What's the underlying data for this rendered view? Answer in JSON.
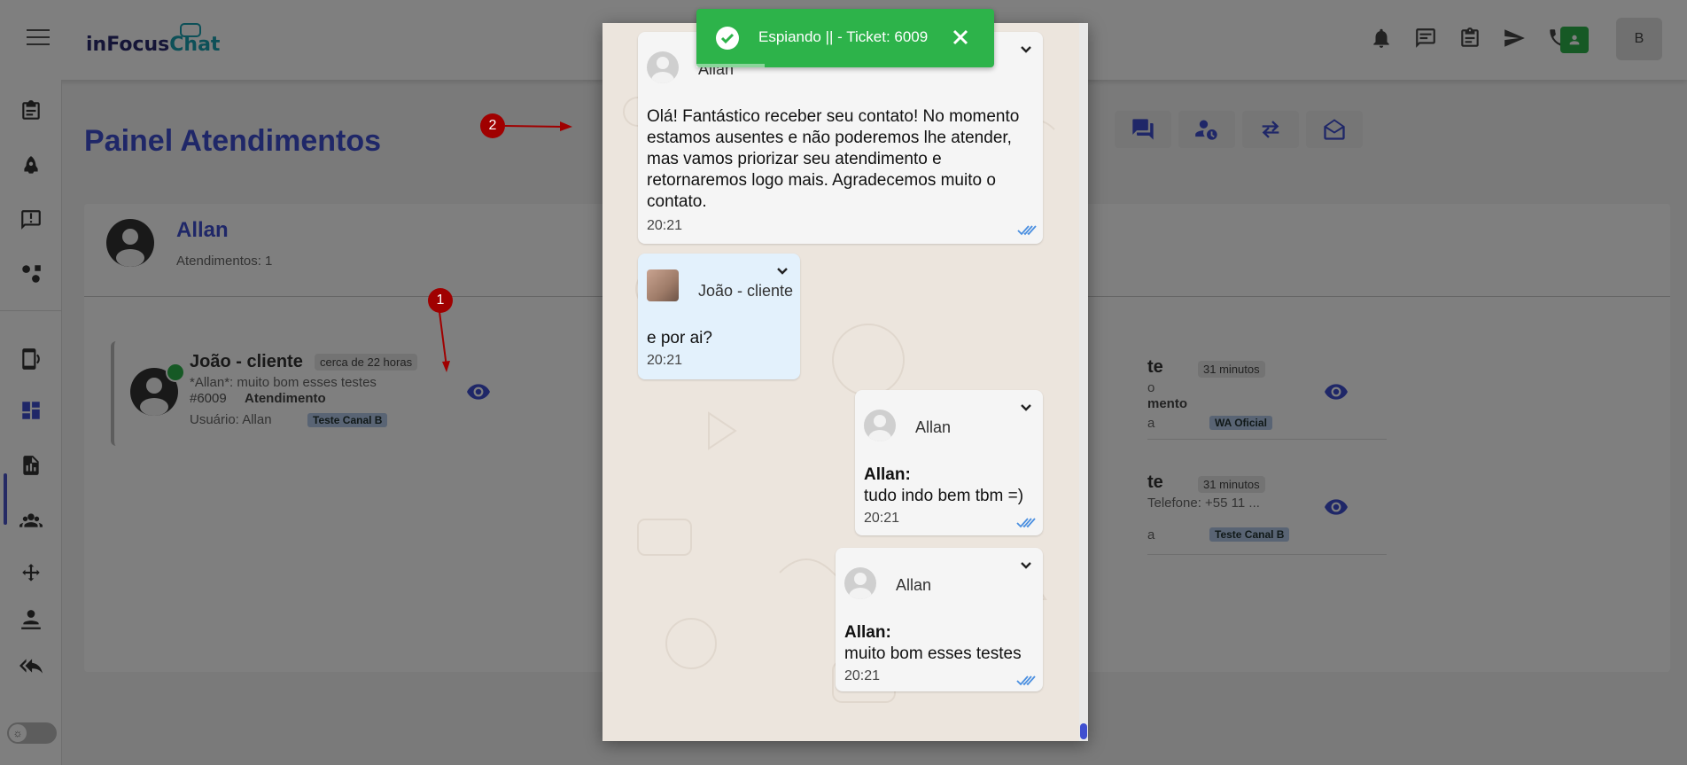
{
  "app": {
    "logo_main": "inFocus",
    "logo_accent": "Chat",
    "user_initial": "B"
  },
  "page": {
    "title": "Painel Atendimentos"
  },
  "panel": {
    "user_name": "Allan",
    "count_label": "Atendimentos: 1"
  },
  "tickets_left": [
    {
      "name": "João - cliente",
      "time": "cerca de 22 horas",
      "last_message": "*Allan*: muito bom esses testes",
      "ticket_id": "#6009",
      "status": "Atendimento",
      "user": "Usuário: Allan",
      "tag": "Teste Canal B"
    }
  ],
  "tickets_right": [
    {
      "name_fragment": "te",
      "time": "31 minutos",
      "line2": "o",
      "status_fragment": "mento",
      "user_fragment": "a",
      "tag": "WA Oficial"
    },
    {
      "name_fragment": "te",
      "time": "31 minutos",
      "line2": "Telefone: +55 11 ...",
      "user_fragment": "a",
      "tag": "Teste Canal B"
    }
  ],
  "annotations": {
    "marker_1": "1",
    "marker_2": "2"
  },
  "toast": {
    "text": "Espiando || - Ticket: 6009",
    "progress_pct": 23
  },
  "chat": {
    "messages": [
      {
        "sender": "Allan",
        "text": "Olá! Fantástico receber seu contato! No momento estamos ausentes e não poderemos lhe atender, mas vamos priorizar seu atendimento e retornaremos logo mais. Agradecemos muito o contato.",
        "time": "20:21"
      },
      {
        "sender": "João - cliente",
        "text": "e por ai?",
        "time": "20:21"
      },
      {
        "sender": "Allan",
        "bold_prefix": "Allan:",
        "text": "tudo indo bem tbm =)",
        "time": "20:21"
      },
      {
        "sender": "Allan",
        "bold_prefix": "Allan:",
        "text": "muito bom esses testes",
        "time": "20:21"
      }
    ]
  },
  "colors": {
    "primary": "#3f4fd0",
    "toast_green": "#2db34a",
    "marker_red": "#a00000",
    "tag_blue": "#b3c9e8"
  }
}
